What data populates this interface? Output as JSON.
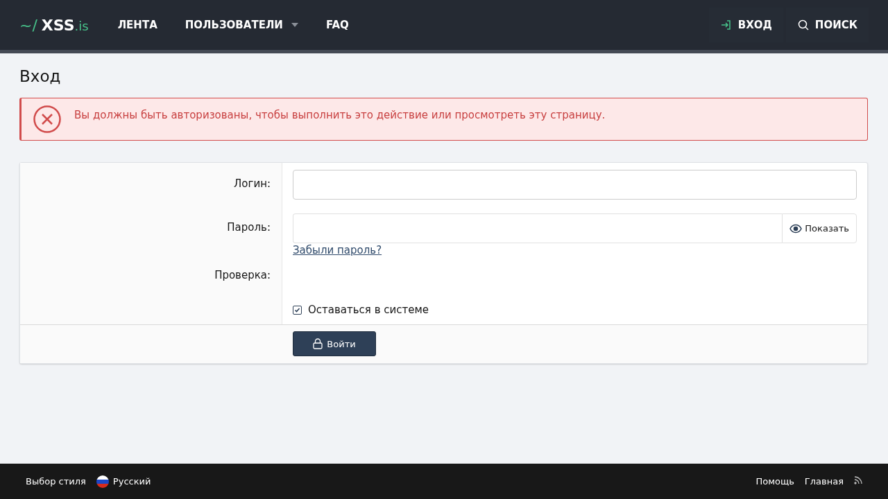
{
  "header": {
    "logo": {
      "prefix": "~/",
      "name": "XSS",
      "suffix": ".is"
    },
    "nav": [
      {
        "label": "ЛЕНТА",
        "dropdown": false
      },
      {
        "label": "ПОЛЬЗОВАТЕЛИ",
        "dropdown": true
      },
      {
        "label": "FAQ",
        "dropdown": false
      }
    ],
    "actions": [
      {
        "label": "ВХОД",
        "kind": "login"
      },
      {
        "label": "ПОИСК",
        "kind": "search"
      }
    ]
  },
  "page_title": "Вход",
  "error": {
    "message": "Вы должны быть авторизованы, чтобы выполнить это действие или просмотреть эту страницу."
  },
  "form": {
    "login": {
      "label": "Логин:"
    },
    "password": {
      "label": "Пароль:",
      "show_button": "Показать",
      "forgot_link": "Забыли пароль?"
    },
    "captcha": {
      "label": "Проверка:"
    },
    "remember": {
      "label": "Оставаться в системе",
      "checked": true
    },
    "submit": "Войти"
  },
  "footer": {
    "left": [
      {
        "label": "Выбор стиля",
        "kind": "text"
      },
      {
        "label": "Русский",
        "kind": "language"
      }
    ],
    "right": [
      {
        "label": "Помощь",
        "kind": "text"
      },
      {
        "label": "Главная",
        "kind": "text"
      },
      {
        "kind": "rss"
      }
    ]
  }
}
